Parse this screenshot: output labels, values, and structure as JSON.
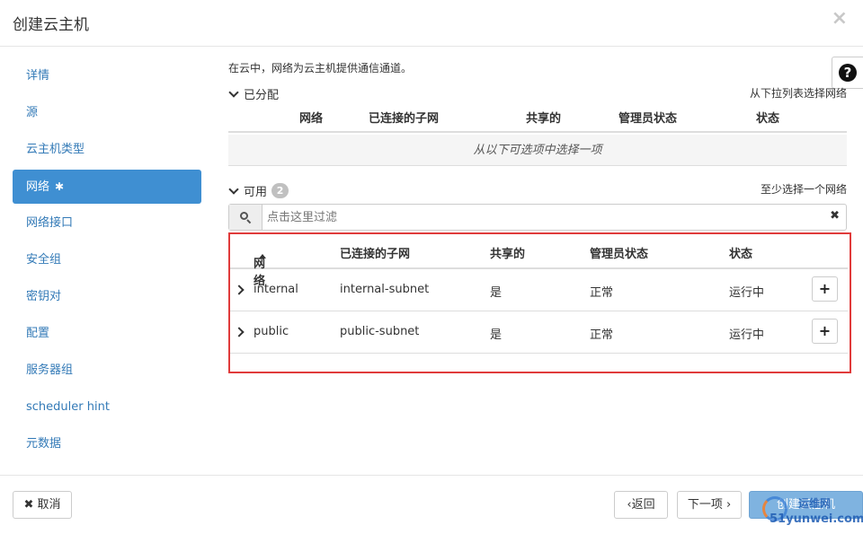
{
  "modal": {
    "title": "创建云主机",
    "close_icon": "close-icon"
  },
  "sidebar": {
    "items": [
      {
        "label": "详情"
      },
      {
        "label": "源"
      },
      {
        "label": "云主机类型"
      },
      {
        "label": "网络",
        "required_mark": "✱",
        "active": true
      },
      {
        "label": "网络接口"
      },
      {
        "label": "安全组"
      },
      {
        "label": "密钥对"
      },
      {
        "label": "配置"
      },
      {
        "label": "服务器组"
      },
      {
        "label": "scheduler hint"
      },
      {
        "label": "元数据"
      }
    ]
  },
  "help": {
    "glyph": "?"
  },
  "main": {
    "intro": "在云中，网络为云主机提供通信通道。",
    "allocated": {
      "title": "已分配",
      "hint": "从下拉列表选择网络",
      "columns": [
        "网络",
        "已连接的子网",
        "共享的",
        "管理员状态",
        "状态"
      ],
      "empty_text": "从以下可选项中选择一项"
    },
    "available": {
      "title": "可用",
      "count": "2",
      "hint": "至少选择一个网络",
      "filter_placeholder": "点击这里过滤",
      "clear_glyph": "✖",
      "columns": [
        "网络",
        "已连接的子网",
        "共享的",
        "管理员状态",
        "状态"
      ],
      "rows": [
        {
          "network": "internal",
          "subnet": "internal-subnet",
          "shared": "是",
          "admin_state": "正常",
          "status": "运行中",
          "action": "+"
        },
        {
          "network": "public",
          "subnet": "public-subnet",
          "shared": "是",
          "admin_state": "正常",
          "status": "运行中",
          "action": "+"
        }
      ]
    }
  },
  "footer": {
    "cancel_glyph": "✖",
    "cancel_label": "取消",
    "back_label": "‹返回",
    "next_label": "下一项 ›",
    "create_label": "创建云主机"
  },
  "watermark": {
    "line1": "运维网",
    "line2": "51yunwei.com"
  },
  "colors": {
    "accent": "#3f8fd2",
    "highlight_border": "#e03b3b",
    "link": "#337ab7"
  }
}
